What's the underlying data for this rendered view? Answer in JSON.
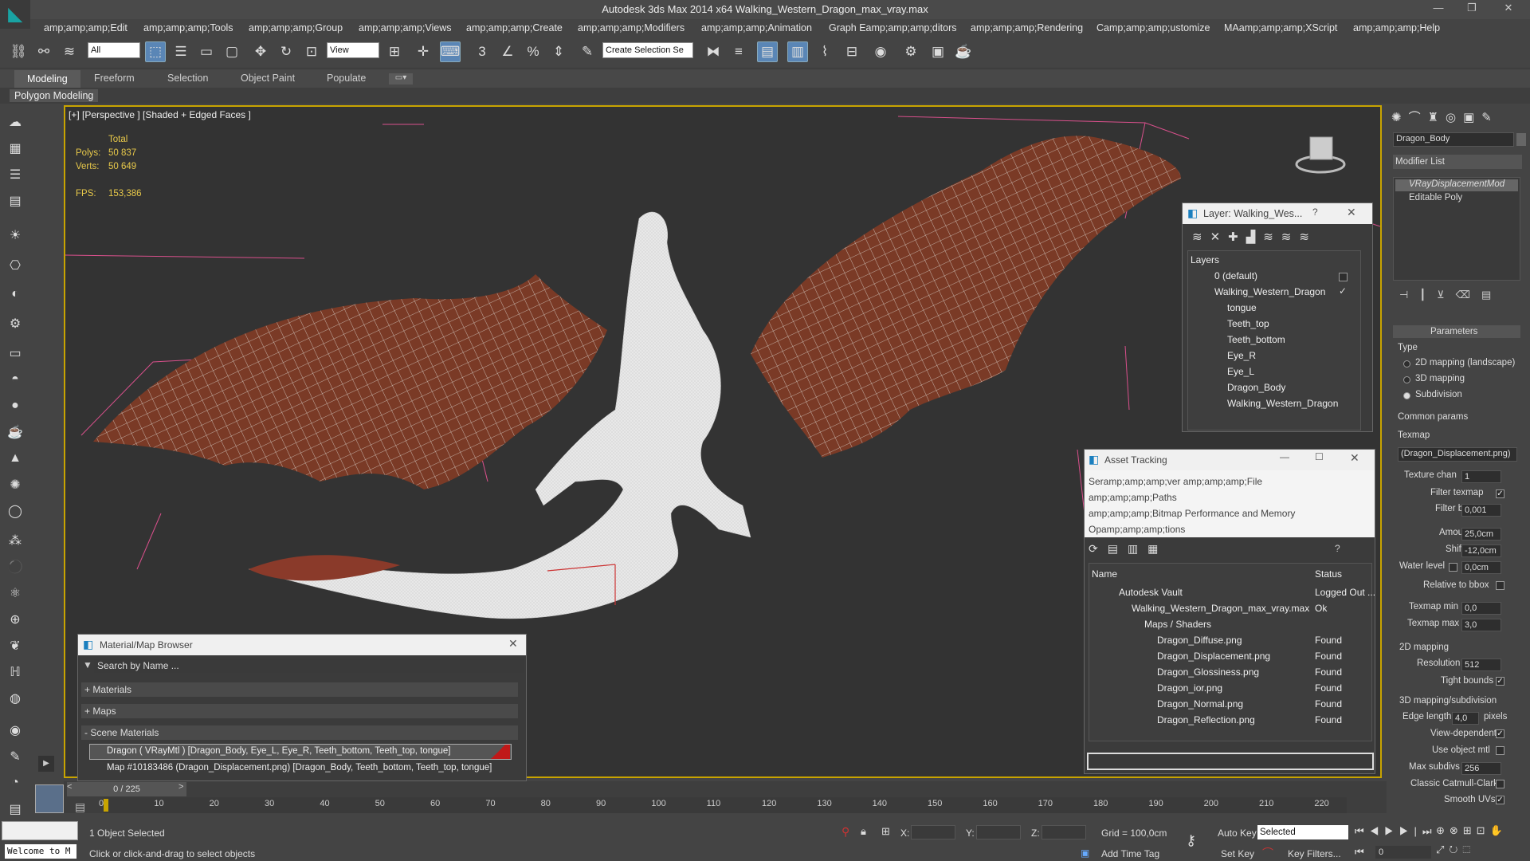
{
  "window": {
    "title": "Autodesk 3ds Max  2014 x64    Walking_Western_Dragon_max_vray.max"
  },
  "menu": [
    "amp;amp;amp;Edit",
    "amp;amp;amp;Tools",
    "amp;amp;amp;Group",
    "amp;amp;amp;Views",
    "amp;amp;amp;Create",
    "amp;amp;amp;Modifiers",
    "amp;amp;amp;Animation",
    "Graph Eamp;amp;amp;ditors",
    "amp;amp;amp;Rendering",
    "Camp;amp;amp;ustomize",
    "MAamp;amp;amp;XScript",
    "amp;amp;amp;Help"
  ],
  "toolbar": {
    "filter": "All",
    "coord": "View",
    "selection_set": "Create Selection Se"
  },
  "ribbon": {
    "tabs": [
      "Modeling",
      "Freeform",
      "Selection",
      "Object Paint",
      "Populate"
    ],
    "sub": "Polygon Modeling"
  },
  "viewport": {
    "label": "[+] [Perspective ] [Shaded + Edged Faces ]",
    "total": "Total",
    "polys_label": "Polys:",
    "polys": "50 837",
    "verts_label": "Verts:",
    "verts": "50 649",
    "fps_label": "FPS:",
    "fps": "153,386"
  },
  "layer_window": {
    "title": "Layer: Walking_Wes...",
    "header": "Layers",
    "items": [
      "0 (default)",
      "Walking_Western_Dragon",
      "tongue",
      "Teeth_top",
      "Teeth_bottom",
      "Eye_R",
      "Eye_L",
      "Dragon_Body",
      "Walking_Western_Dragon"
    ]
  },
  "asset_window": {
    "title": "Asset Tracking",
    "menu1": "Seramp;amp;amp;ver   amp;amp;amp;File",
    "menu2": "amp;amp;amp;Paths",
    "menu3": "amp;amp;amp;Bitmap Performance and Memory",
    "menu4": "Opamp;amp;amp;tions",
    "col_name": "Name",
    "col_status": "Status",
    "rows": [
      {
        "name": "Autodesk Vault",
        "status": "Logged Out ..."
      },
      {
        "name": "Walking_Western_Dragon_max_vray.max",
        "status": "Ok"
      },
      {
        "name": "Maps / Shaders",
        "status": ""
      },
      {
        "name": "Dragon_Diffuse.png",
        "status": "Found"
      },
      {
        "name": "Dragon_Displacement.png",
        "status": "Found"
      },
      {
        "name": "Dragon_Glossiness.png",
        "status": "Found"
      },
      {
        "name": "Dragon_ior.png",
        "status": "Found"
      },
      {
        "name": "Dragon_Normal.png",
        "status": "Found"
      },
      {
        "name": "Dragon_Reflection.png",
        "status": "Found"
      }
    ]
  },
  "material_window": {
    "title": "Material/Map Browser",
    "search": "Search by Name ...",
    "sections": [
      "+ Materials",
      "+ Maps",
      "- Scene Materials"
    ],
    "item1": "Dragon  ( VRayMtl ) [Dragon_Body, Eye_L, Eye_R, Teeth_bottom, Teeth_top, tongue]",
    "item2": "Map #10183486 (Dragon_Displacement.png) [Dragon_Body, Teeth_bottom, Teeth_top, tongue]"
  },
  "right": {
    "object": "Dragon_Body",
    "modlist": "Modifier List",
    "stack": [
      "VRayDisplacementMod",
      "Editable Poly"
    ],
    "params": "Parameters",
    "type": "Type",
    "r1": "2D mapping (landscape)",
    "r2": "3D mapping",
    "r3": "Subdivision",
    "common": "Common params",
    "texmap": "Texmap",
    "texmap_val": "(Dragon_Displacement.png)",
    "tex_chan": "Texture chan",
    "tex_chan_val": "1",
    "filter_texmap": "Filter texmap",
    "filter_blur": "Filter blur",
    "filter_blur_val": "0,001",
    "amount": "Amount",
    "amount_val": "25,0cm",
    "shift": "Shift",
    "shift_val": "-12,0cm",
    "water": "Water level",
    "water_val": "0,0cm",
    "relbbox": "Relative to bbox",
    "tmin": "Texmap min",
    "tmin_val": "0,0",
    "tmax": "Texmap max",
    "tmax_val": "3,0",
    "map2d": "2D mapping",
    "res": "Resolution",
    "res_val": "512",
    "tight": "Tight bounds",
    "map3d": "3D mapping/subdivision",
    "edge": "Edge length",
    "edge_val": "4,0",
    "pixels": "pixels",
    "viewdep": "View-dependent",
    "useobj": "Use object mtl",
    "maxsub": "Max subdivs",
    "maxsub_val": "256",
    "catmull": "Classic Catmull-Clark",
    "smooth": "Smooth UVs"
  },
  "timeline": {
    "frame": "0 / 225",
    "ticks": [
      "0",
      "10",
      "20",
      "30",
      "40",
      "50",
      "60",
      "70",
      "80",
      "90",
      "100",
      "110",
      "120",
      "130",
      "140",
      "150",
      "160",
      "170",
      "180",
      "190",
      "200",
      "210",
      "220"
    ]
  },
  "status": {
    "welcome": "Welcome to M",
    "selected": "1 Object Selected",
    "hint": "Click or click-and-drag to select objects",
    "x": "X:",
    "y": "Y:",
    "z": "Z:",
    "grid": "Grid = 100,0cm",
    "addtime": "Add Time Tag",
    "autokey": "Auto Key",
    "selected_mode": "Selected",
    "setkey": "Set Key",
    "keyfilters": "Key Filters...",
    "frame": "0"
  }
}
